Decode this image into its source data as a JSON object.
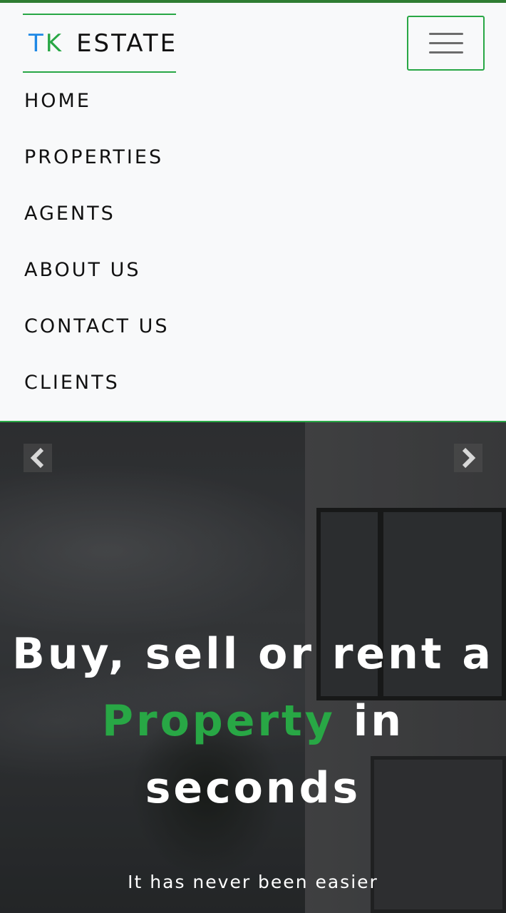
{
  "brand": {
    "part1": "T",
    "part2": "K",
    "part3": "ESTATE"
  },
  "nav": {
    "items": [
      {
        "label": "HOME"
      },
      {
        "label": "PROPERTIES"
      },
      {
        "label": "AGENTS"
      },
      {
        "label": "ABOUT US"
      },
      {
        "label": "CONTACT US"
      },
      {
        "label": "CLIENTS"
      }
    ],
    "toggler_icon": "hamburger-menu-icon"
  },
  "hero": {
    "title_line1": "Buy, sell or rent a",
    "title_accent": "Property",
    "title_after_accent": " in",
    "title_line3": "seconds",
    "subtitle": "It has never been easier",
    "prev_icon": "chevron-left-icon",
    "next_icon": "chevron-right-icon"
  },
  "colors": {
    "accent_green": "#28a745",
    "brand_blue": "#1e88e5",
    "nav_bg": "#f8f9fa",
    "text": "#111111"
  }
}
